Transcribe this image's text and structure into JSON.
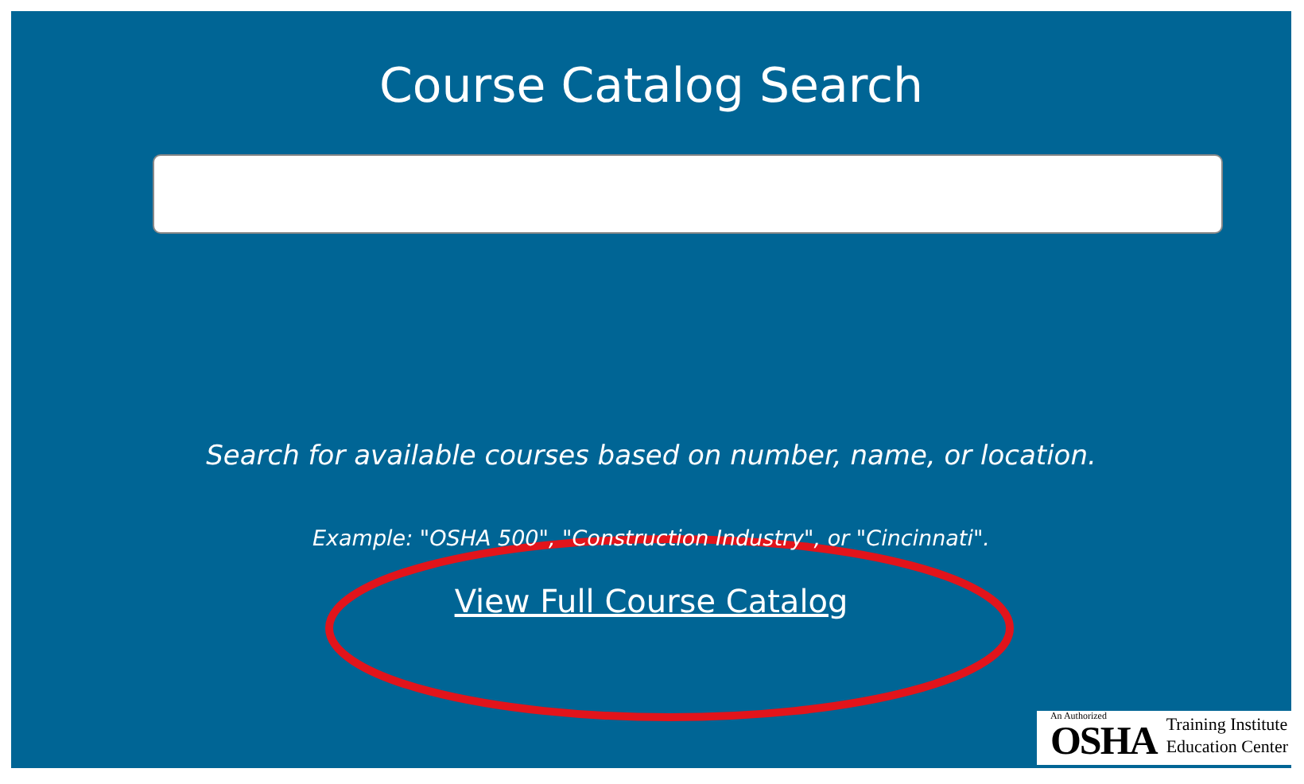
{
  "title": "Course Catalog Search",
  "description": "Search for available courses based on number, name, or location.",
  "example": "Example: \"OSHA 500\", \"Construction Industry\", or \"Cincinnati\".",
  "link": "View Full Course Catalog",
  "badge": {
    "top": "An Authorized",
    "mark": "OSHA",
    "line_1": "Training Institute",
    "line_2": "Education Center"
  }
}
